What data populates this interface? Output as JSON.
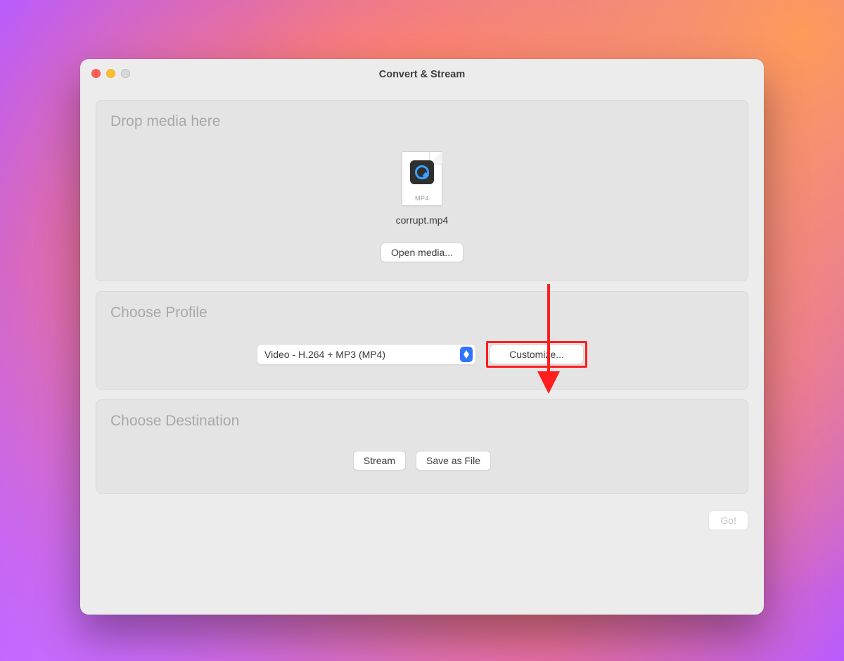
{
  "window": {
    "title": "Convert & Stream"
  },
  "drop": {
    "heading": "Drop media here",
    "file_type_label": "MP4",
    "filename": "corrupt.mp4",
    "open_button": "Open media..."
  },
  "profile": {
    "heading": "Choose Profile",
    "selected": "Video - H.264 + MP3 (MP4)",
    "customize_button": "Customize..."
  },
  "destination": {
    "heading": "Choose Destination",
    "stream_button": "Stream",
    "save_button": "Save as File"
  },
  "footer": {
    "go_button": "Go!"
  },
  "annotation": {
    "arrow_color": "#ff1d1d"
  }
}
